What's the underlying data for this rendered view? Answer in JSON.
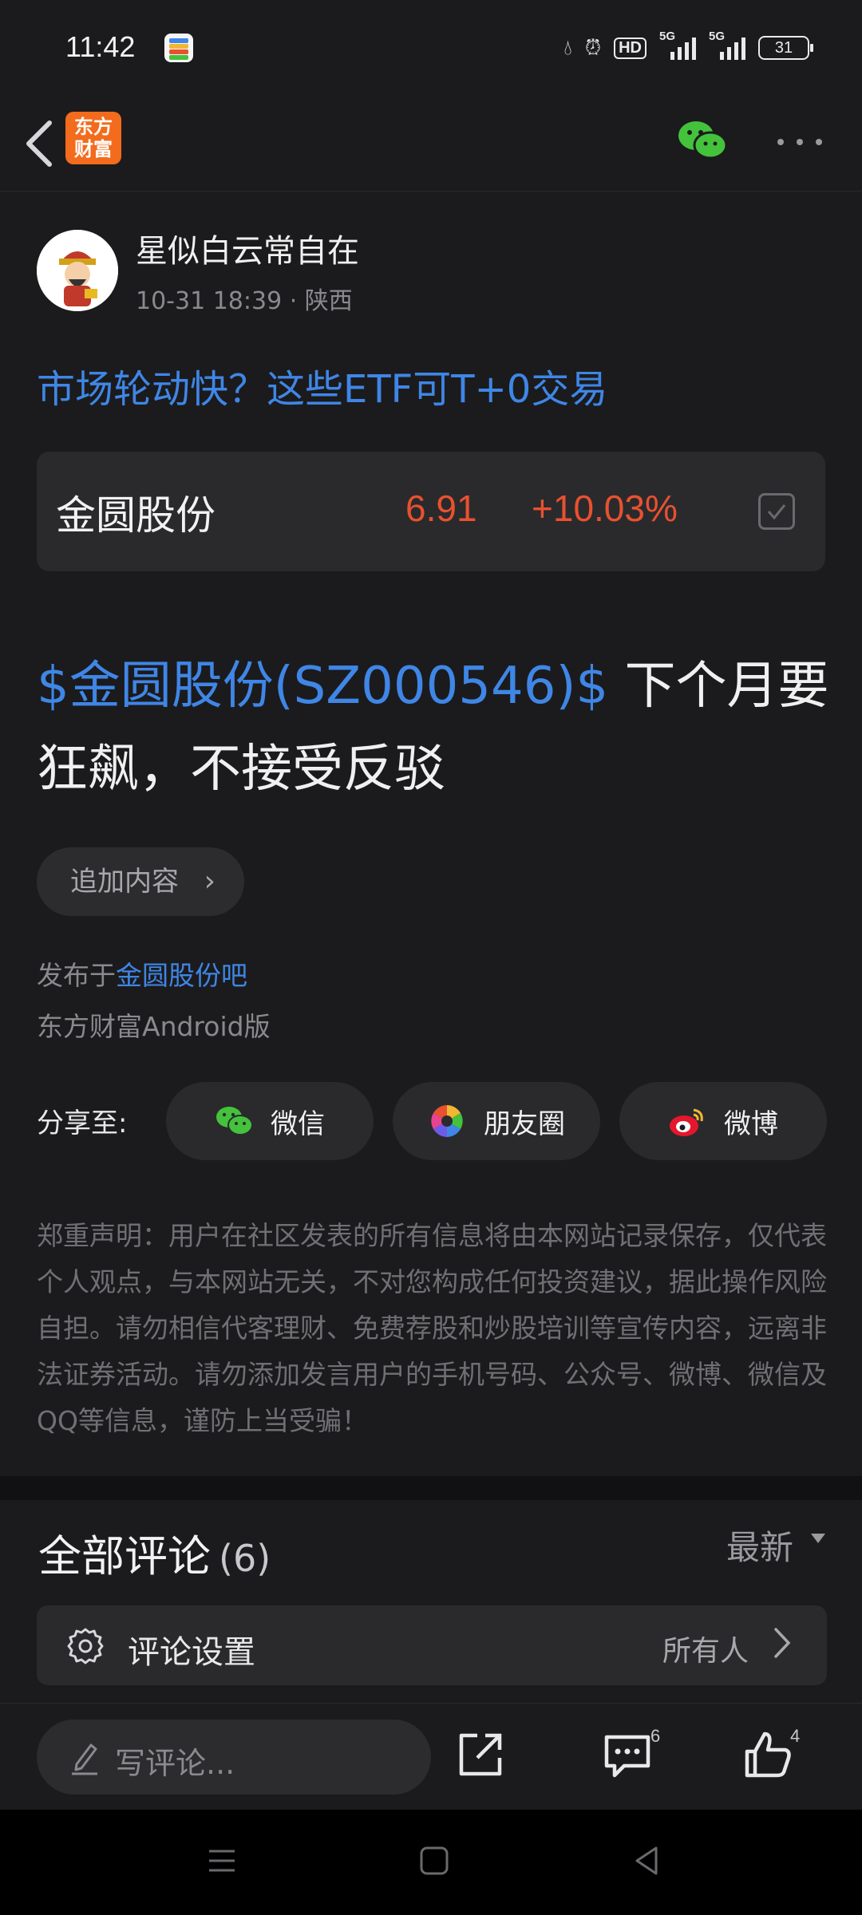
{
  "status_bar": {
    "time": "11:42",
    "hd_label": "HD",
    "net_1": "5G",
    "net_2": "5G",
    "battery": "31"
  },
  "nav": {
    "logo_line1": "东方",
    "logo_line2": "财富"
  },
  "author": {
    "name": "星似白云常自在",
    "date": "10-31 18:39",
    "location": "· 陕西"
  },
  "topic_link": "市场轮动快？这些ETF可T+0交易",
  "stock": {
    "name": "金圆股份",
    "price": "6.91",
    "change": "+10.03%",
    "color_up": "#e8512f"
  },
  "post": {
    "tag": "$金圆股份(SZ000546)$",
    "text": " 下个月要狂飙，不接受反驳"
  },
  "append_button": "追加内容",
  "published": {
    "prefix": "发布于",
    "bar": "金圆股份吧",
    "platform": "东方财富Android版"
  },
  "share": {
    "label": "分享至:",
    "wechat": "微信",
    "moments": "朋友圈",
    "weibo": "微博"
  },
  "disclaimer": "郑重声明：用户在社区发表的所有信息将由本网站记录保存，仅代表个人观点，与本网站无关，不对您构成任何投资建议，据此操作风险自担。请勿相信代客理财、免费荐股和炒股培训等宣传内容，远离非法证券活动。请勿添加发言用户的手机号码、公众号、微博、微信及QQ等信息，谨防上当受骗！",
  "comments": {
    "title": "全部评论",
    "count": "(6)",
    "sort": "最新"
  },
  "comment_settings": {
    "label": "评论设置",
    "value": "所有人"
  },
  "bottom": {
    "write_placeholder": "写评论...",
    "comment_count": "6",
    "like_count": "4"
  },
  "colors": {
    "link": "#3f86e6",
    "background": "#1b1b1d",
    "card": "#2a2a2c",
    "wechat_green": "#44c23c"
  }
}
